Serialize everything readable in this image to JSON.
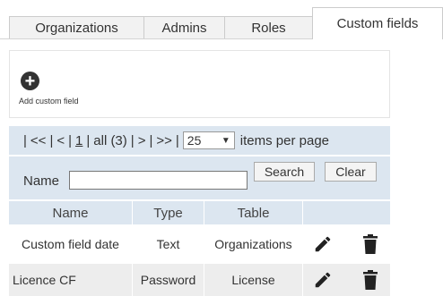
{
  "tabs": [
    "Organizations",
    "Admins",
    "Roles",
    "Custom fields"
  ],
  "toolbar": {
    "add_label": "Add custom field",
    "add_icon": "plus-circle-icon"
  },
  "pager": {
    "open": "|",
    "first": "<<",
    "prev": "<",
    "current": "1",
    "all": "all (3)",
    "next": ">",
    "last": ">>",
    "per_page_value": "25",
    "per_page_label": "items per page"
  },
  "search": {
    "label": "Name",
    "value": "",
    "search_button": "Search",
    "clear_button": "Clear"
  },
  "table": {
    "headers": [
      "Name",
      "Type",
      "Table"
    ],
    "rows": [
      {
        "name": "Custom field date",
        "type": "Text",
        "table": "Organizations"
      },
      {
        "name": "Licence CF",
        "type": "Password",
        "table": "License"
      }
    ],
    "row_icons": [
      "pencil-icon",
      "trash-icon"
    ]
  },
  "colors": {
    "header_bg": "#dce6f0",
    "alt_row_bg": "#ededed",
    "icon": "#222222"
  }
}
